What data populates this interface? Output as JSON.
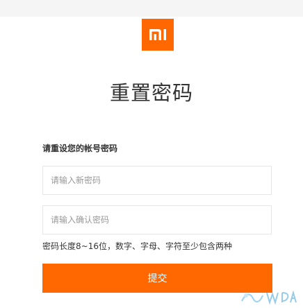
{
  "brand": {
    "logo_icon": "mi-logo-icon",
    "accent_color": "#ff6700"
  },
  "page": {
    "title": "重置密码"
  },
  "form": {
    "prompt": "请重设您的帐号密码",
    "new_password_placeholder": "请输入新密码",
    "confirm_password_placeholder": "请输入确认密码",
    "hint": "密码长度8~16位，数字、字母、字符至少包含两种",
    "submit_label": "提交"
  }
}
